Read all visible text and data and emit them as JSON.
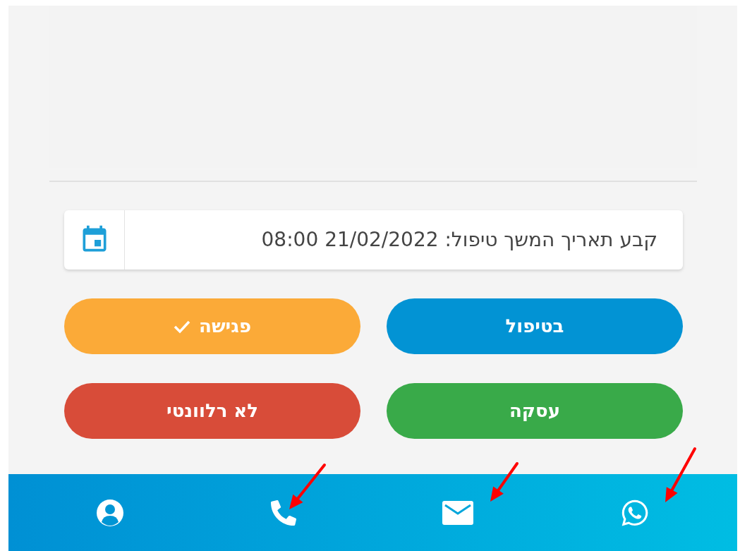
{
  "follow_up": {
    "label": "קבע תאריך המשך טיפול: 21/02/2022 08:00"
  },
  "status_buttons": [
    {
      "label": "בטיפול",
      "color": "#0293d4",
      "checked": false
    },
    {
      "label": "פגישה",
      "color": "#fbaa38",
      "checked": true
    },
    {
      "label": "עסקה",
      "color": "#39aa49",
      "checked": false
    },
    {
      "label": "לא רלוונטי",
      "color": "#d84c39",
      "checked": false
    }
  ]
}
